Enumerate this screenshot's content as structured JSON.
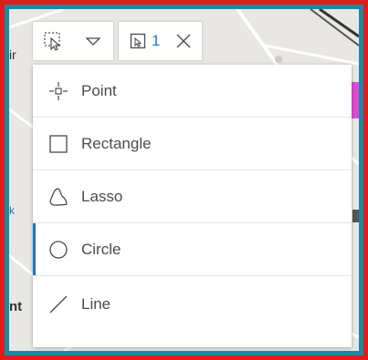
{
  "toolbar": {
    "select_tool_icon": "cursor-select-icon",
    "dropdown_icon": "chevron-down-icon",
    "selection_count_icon": "selection-box-icon",
    "selection_count": "1",
    "close_icon": "close-icon"
  },
  "menu": {
    "items": [
      {
        "label": "Point",
        "icon": "point-icon"
      },
      {
        "label": "Rectangle",
        "icon": "rectangle-icon"
      },
      {
        "label": "Lasso",
        "icon": "lasso-icon"
      },
      {
        "label": "Circle",
        "icon": "circle-icon",
        "selected": true
      },
      {
        "label": "Line",
        "icon": "line-icon"
      }
    ]
  },
  "map": {
    "partial_labels": [
      "ir",
      "k",
      "nt"
    ]
  },
  "colors": {
    "outer_border": "#e31b1b",
    "inner_border": "#1a8aa3",
    "accent": "#1a78c2",
    "highlight_pink": "#e04ad6"
  }
}
